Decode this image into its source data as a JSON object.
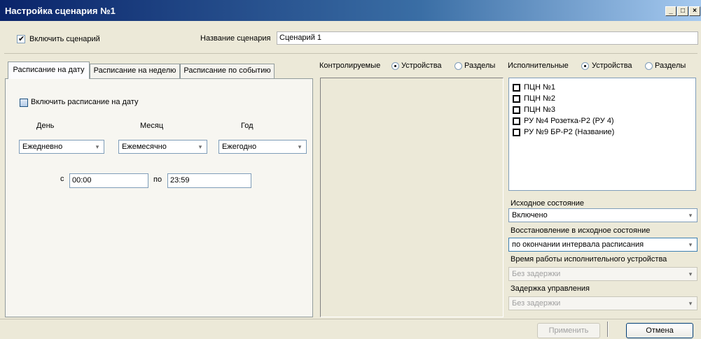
{
  "window": {
    "title": "Настройка сценария №1",
    "controls": {
      "minimize": "_",
      "maximize": "□",
      "close": "×"
    }
  },
  "header": {
    "enable_checkbox": {
      "label": "Включить сценарий",
      "checked": true
    },
    "name_label": "Название сценария",
    "name_value": "Сценарий 1"
  },
  "tabs": [
    {
      "label": "Расписание на дату",
      "active": true
    },
    {
      "label": "Расписание на неделю",
      "active": false
    },
    {
      "label": "Расписание по событию",
      "active": false
    }
  ],
  "date_schedule": {
    "enable_checkbox": {
      "label": "Включить расписание на дату",
      "checked": false
    },
    "day_label": "День",
    "month_label": "Месяц",
    "year_label": "Год",
    "day_value": "Ежедневно",
    "month_value": "Ежемесячно",
    "year_value": "Ежегодно",
    "from_label": "с",
    "from_value": "00:00",
    "to_label": "по",
    "to_value": "23:59"
  },
  "controlled": {
    "label": "Контролируемые",
    "radio_devices": "Устройства",
    "radio_sections": "Разделы",
    "selected": "devices"
  },
  "executive": {
    "label": "Исполнительные",
    "radio_devices": "Устройства",
    "radio_sections": "Разделы",
    "selected": "devices",
    "items": [
      {
        "label": "ПЦН №1",
        "checked": false
      },
      {
        "label": "ПЦН №2",
        "checked": false
      },
      {
        "label": "ПЦН №3",
        "checked": false
      },
      {
        "label": "РУ №4  Розетка-Р2 (РУ 4)",
        "checked": false
      },
      {
        "label": "РУ №9  БР-Р2 (Название)",
        "checked": false
      }
    ]
  },
  "settings": {
    "initial_state_label": "Исходное состояние",
    "initial_state_value": "Включено",
    "restore_label": "Восстановление в исходное состояние",
    "restore_value": "по окончании интервала расписания",
    "work_time_label": "Время работы исполнительного устройства",
    "work_time_value": "Без задержки",
    "control_delay_label": "Задержка управления",
    "control_delay_value": "Без задержки"
  },
  "footer": {
    "apply_label": "Применить",
    "cancel_label": "Отмена"
  },
  "colors": {
    "title_bar_start": "#0a246a",
    "title_bar_end": "#a6caf0",
    "window_bg": "#ece9d8",
    "input_border": "#7f9db9"
  }
}
